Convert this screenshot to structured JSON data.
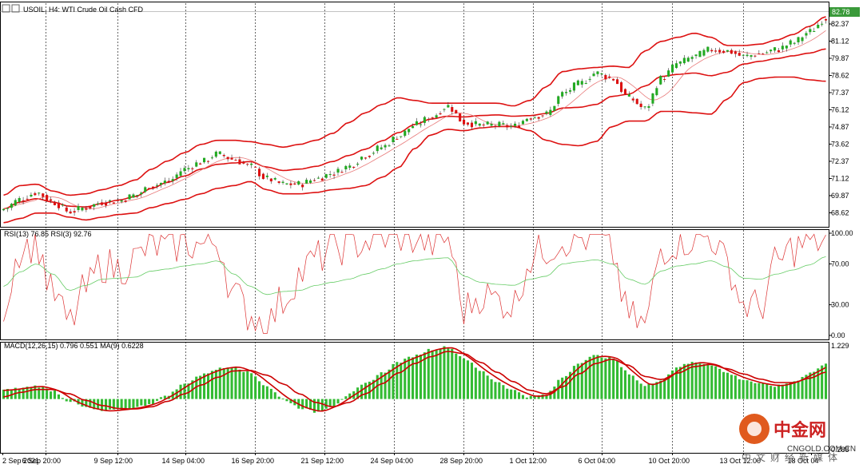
{
  "header": {
    "symbol": "USOIL, H4:  WTI Crude Oil Cash CFD",
    "current_price": "82.78"
  },
  "colors": {
    "bull": "#22aa22",
    "bear": "#dd1111",
    "band": "#dd1111",
    "ma": "#e87a7a",
    "rsi13": "#dd3333",
    "rsi3": "#66cc66",
    "macd_hist": "#33bb33",
    "macd_line": "#cc0000",
    "grid": "#000000"
  },
  "price_panel": {
    "y_labels": [
      "82.37",
      "81.12",
      "79.87",
      "78.62",
      "77.37",
      "76.12",
      "74.87",
      "73.62",
      "72.37",
      "71.12",
      "69.87",
      "68.62"
    ],
    "ylim": [
      67.6,
      83.3
    ]
  },
  "rsi_panel": {
    "title": "RSI(13) 76.85  RSI(3) 92.76",
    "y_labels": [
      "100.00",
      "70.00",
      "30.00",
      "0.00"
    ]
  },
  "macd_panel": {
    "title": "MACD(12,26,15) 0.796 0.551 MA(9) 0.6228",
    "y_labels": [
      "1.229",
      "0.288"
    ],
    "ylim": [
      -1.15,
      1.229
    ]
  },
  "time_axis": {
    "labels": [
      "2 Sep 2021",
      "6 Sep 20:00",
      "9 Sep 12:00",
      "14 Sep 04:00",
      "16 Sep 20:00",
      "21 Sep 12:00",
      "24 Sep 04:00",
      "28 Sep 20:00",
      "1 Oct 12:00",
      "6 Oct 04:00",
      "10 Oct 20:00",
      "13 Oct 12:00",
      "18 Oct 04"
    ]
  },
  "watermark": {
    "logo": "中金网",
    "url": "CNGOLD.COM.CN",
    "tagline": "中文财经新媒体"
  },
  "chart_data": [
    {
      "type": "candlestick",
      "title": "USOIL, H4:  WTI Crude Oil Cash CFD",
      "ylim": [
        67.6,
        83.3
      ],
      "close_anchors": [
        68.9,
        69.6,
        70.1,
        69.4,
        68.7,
        69.0,
        69.4,
        69.5,
        69.9,
        70.6,
        70.9,
        71.8,
        72.3,
        72.9,
        72.5,
        72.0,
        71.1,
        70.7,
        70.7,
        71.1,
        71.5,
        72.0,
        72.8,
        73.4,
        74.2,
        75.0,
        75.6,
        76.4,
        75.2,
        75.0,
        75.0,
        74.9,
        75.6,
        75.8,
        77.3,
        78.0,
        78.8,
        78.4,
        77.0,
        76.2,
        78.4,
        79.5,
        80.0,
        80.5,
        80.4,
        80.0,
        80.2,
        80.5,
        81.0,
        81.8,
        82.8
      ],
      "upper_band_anchors": [
        69.9,
        70.6,
        70.7,
        70.2,
        69.9,
        70.0,
        70.3,
        70.6,
        71.0,
        71.8,
        72.4,
        73.0,
        73.6,
        73.9,
        73.9,
        73.8,
        73.6,
        73.4,
        73.6,
        73.9,
        74.4,
        75.2,
        75.9,
        76.5,
        77.0,
        76.8,
        76.6,
        76.6,
        76.6,
        76.6,
        76.6,
        76.4,
        76.8,
        77.8,
        78.9,
        79.1,
        79.2,
        79.3,
        79.2,
        80.4,
        81.1,
        81.4,
        81.7,
        81.4,
        80.8,
        80.8,
        80.9,
        81.2,
        81.6,
        82.2,
        82.9
      ],
      "lower_band_anchors": [
        67.9,
        68.2,
        68.6,
        68.6,
        68.3,
        68.1,
        68.3,
        68.5,
        68.6,
        69.0,
        69.3,
        69.6,
        70.0,
        70.4,
        70.6,
        70.9,
        70.3,
        70.0,
        70.0,
        70.1,
        70.3,
        70.4,
        70.6,
        71.2,
        71.9,
        73.3,
        74.3,
        74.7,
        74.6,
        74.8,
        74.9,
        74.9,
        74.6,
        73.9,
        73.6,
        73.5,
        73.8,
        74.9,
        75.3,
        75.3,
        76.0,
        76.0,
        75.9,
        75.8,
        76.9,
        78.1,
        78.4,
        78.5,
        78.5,
        78.3,
        78.2
      ]
    },
    {
      "type": "line",
      "title": "RSI(13) 76.85  RSI(3) 92.76",
      "ylim": [
        0,
        100
      ],
      "series": [
        {
          "name": "RSI(13)",
          "values": [
            48,
            62,
            70,
            60,
            44,
            49,
            55,
            56,
            57,
            63,
            65,
            68,
            70,
            73,
            60,
            48,
            40,
            43,
            44,
            49,
            52,
            55,
            60,
            65,
            70,
            73,
            75,
            76,
            58,
            52,
            50,
            49,
            55,
            58,
            70,
            72,
            74,
            70,
            55,
            50,
            63,
            68,
            70,
            73,
            67,
            56,
            55,
            60,
            64,
            69,
            77
          ]
        },
        {
          "name": "RSI(3)",
          "values": [
            30,
            85,
            90,
            40,
            12,
            45,
            70,
            65,
            75,
            88,
            85,
            90,
            88,
            92,
            40,
            20,
            10,
            35,
            60,
            75,
            85,
            88,
            92,
            96,
            98,
            95,
            90,
            95,
            25,
            40,
            35,
            30,
            75,
            85,
            94,
            95,
            96,
            80,
            18,
            10,
            85,
            92,
            95,
            97,
            70,
            30,
            28,
            70,
            85,
            92,
            93
          ]
        }
      ]
    },
    {
      "type": "bar",
      "title": "MACD(12,26,15) 0.796 0.551 MA(9) 0.6228",
      "ylim": [
        -1.15,
        1.229
      ],
      "series": [
        {
          "name": "MACD",
          "values": [
            0.2,
            0.25,
            0.3,
            0.2,
            -0.05,
            -0.2,
            -0.28,
            -0.25,
            -0.2,
            -0.1,
            0.1,
            0.35,
            0.55,
            0.7,
            0.75,
            0.6,
            0.3,
            0.0,
            -0.2,
            -0.3,
            -0.15,
            0.1,
            0.35,
            0.6,
            0.85,
            1.0,
            1.15,
            1.2,
            0.95,
            0.65,
            0.4,
            0.2,
            0.05,
            0.1,
            0.5,
            0.85,
            1.0,
            0.95,
            0.6,
            0.3,
            0.45,
            0.75,
            0.85,
            0.8,
            0.6,
            0.45,
            0.35,
            0.3,
            0.4,
            0.6,
            0.8
          ]
        },
        {
          "name": "MA(9)",
          "values": [
            0.05,
            0.15,
            0.22,
            0.22,
            0.12,
            -0.03,
            -0.15,
            -0.22,
            -0.23,
            -0.18,
            -0.05,
            0.12,
            0.32,
            0.5,
            0.65,
            0.66,
            0.55,
            0.35,
            0.12,
            -0.08,
            -0.18,
            -0.08,
            0.12,
            0.35,
            0.6,
            0.82,
            0.98,
            1.1,
            1.05,
            0.85,
            0.62,
            0.4,
            0.2,
            0.12,
            0.28,
            0.58,
            0.82,
            0.92,
            0.78,
            0.52,
            0.45,
            0.6,
            0.75,
            0.8,
            0.7,
            0.58,
            0.46,
            0.38,
            0.38,
            0.48,
            0.62
          ]
        }
      ]
    }
  ]
}
